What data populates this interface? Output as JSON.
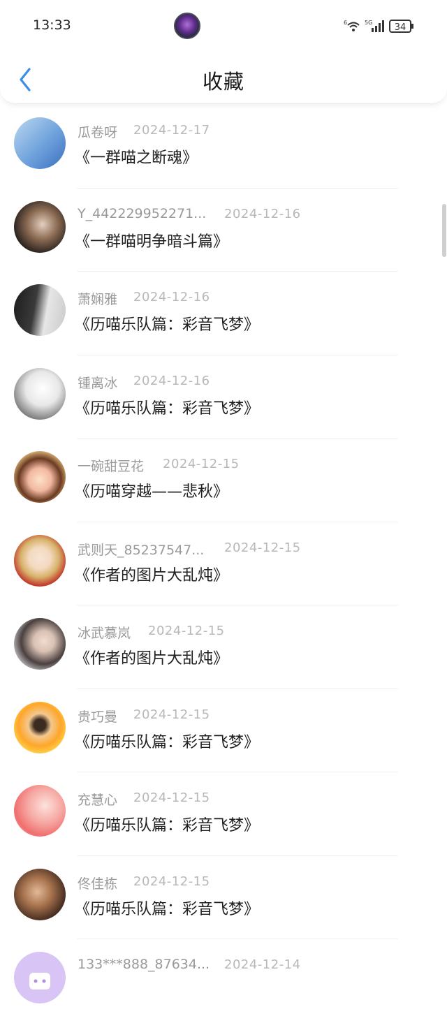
{
  "status": {
    "time": "13:33",
    "battery": "34",
    "network_label": "5G",
    "wifi_label": "6"
  },
  "header": {
    "title": "收藏"
  },
  "favorites": [
    {
      "user": "瓜卷呀",
      "date": "2024-12-17",
      "title": "《一群喵之断魂》"
    },
    {
      "user": "Y_442229952271...",
      "date": "2024-12-16",
      "title": "《一群喵明争暗斗篇》"
    },
    {
      "user": "萧娴雅",
      "date": "2024-12-16",
      "title": "《历喵乐队篇：彩音飞梦》"
    },
    {
      "user": "锺离冰",
      "date": "2024-12-16",
      "title": "《历喵乐队篇：彩音飞梦》"
    },
    {
      "user": "一碗甜豆花",
      "date": "2024-12-15",
      "title": "《历喵穿越——悲秋》"
    },
    {
      "user": "武则天_85237547...",
      "date": "2024-12-15",
      "title": "《作者的图片大乱炖》"
    },
    {
      "user": "冰武慕岚",
      "date": "2024-12-15",
      "title": "《作者的图片大乱炖》"
    },
    {
      "user": "贵巧曼",
      "date": "2024-12-15",
      "title": "《历喵乐队篇：彩音飞梦》"
    },
    {
      "user": "充慧心",
      "date": "2024-12-15",
      "title": "《历喵乐队篇：彩音飞梦》"
    },
    {
      "user": "佟佳栋",
      "date": "2024-12-15",
      "title": "《历喵乐队篇：彩音飞梦》"
    },
    {
      "user": "133***888_87634...",
      "date": "2024-12-14",
      "title": ""
    }
  ]
}
